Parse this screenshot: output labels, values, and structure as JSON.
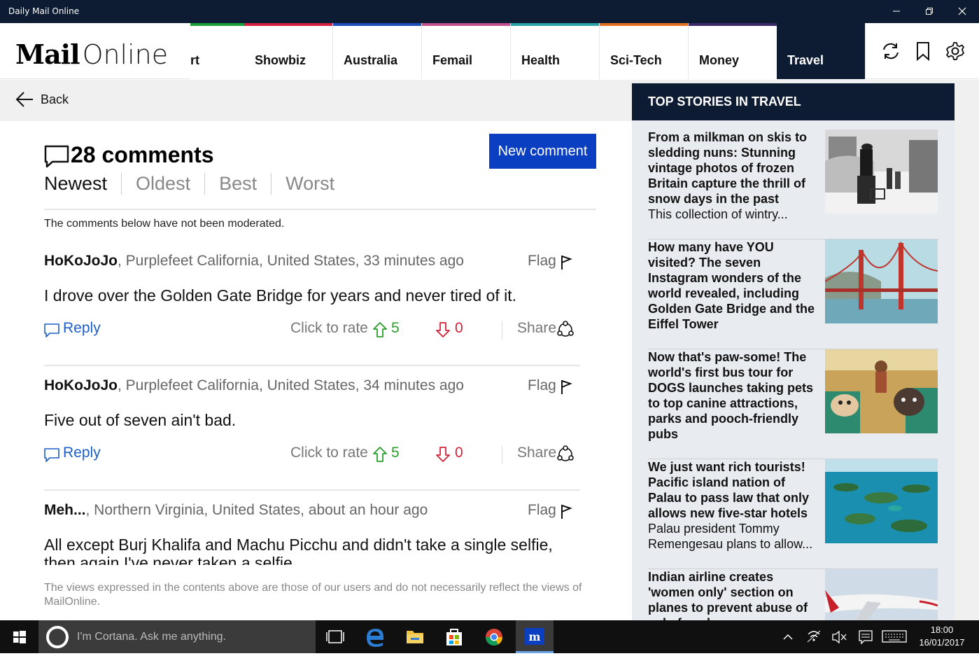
{
  "window": {
    "title": "Daily Mail Online"
  },
  "header": {
    "logo_mail": "Mail",
    "logo_online": "Online",
    "tabs": [
      {
        "label": "rt",
        "color": "#1a9e3a"
      },
      {
        "label": "Showbiz",
        "color": "#d61f43"
      },
      {
        "label": "Australia",
        "color": "#1d4fb8"
      },
      {
        "label": "Femail",
        "color": "#c05090"
      },
      {
        "label": "Health",
        "color": "#2aa3a8"
      },
      {
        "label": "Sci-Tech",
        "color": "#e07020"
      },
      {
        "label": "Money",
        "color": "#3a2a6a"
      },
      {
        "label": "Travel",
        "color": "#0d1b33",
        "active": true
      }
    ],
    "icons": [
      "refresh-icon",
      "bookmark-icon",
      "settings-icon"
    ]
  },
  "nav": {
    "back_label": "Back"
  },
  "comments": {
    "count_label": "28 comments",
    "new_comment_label": "New comment",
    "sorts": [
      "Newest",
      "Oldest",
      "Best",
      "Worst"
    ],
    "active_sort": "Newest",
    "notice": "The comments below have not been moderated.",
    "flag_label": "Flag",
    "reply_label": "Reply",
    "rate_label": "Click to rate",
    "share_label": "Share",
    "items": [
      {
        "author": "HoKoJoJo",
        "location": ", Purplefeet California, United States, 33 minutes ago",
        "text": "I  drove over the Golden Gate Bridge for years and never tired of it.",
        "up": "5",
        "down": "0"
      },
      {
        "author": "HoKoJoJo",
        "location": ", Purplefeet California, United States, 34 minutes ago",
        "text": "Five out of seven ain't bad.",
        "up": "5",
        "down": "0"
      },
      {
        "author": "Meh...",
        "location": ", Northern Virginia, United States, about an hour ago",
        "text": "All except Burj Khalifa and Machu Picchu and didn't take a single selfie, then again I've never taken a selfie."
      }
    ],
    "disclaimer": "The views expressed in the contents above are those of our users and do not necessarily reflect the views of MailOnline."
  },
  "sidebar": {
    "heading": "TOP STORIES IN TRAVEL",
    "stories": [
      {
        "headline": "From a milkman on skis to sledding nuns: Stunning vintage photos of frozen Britain capture the thrill of snow days in the past",
        "summary": "This collection of wintry..."
      },
      {
        "headline": "How many have YOU visited? The seven Instagram wonders of the world revealed, including Golden Gate Bridge and the Eiffel Tower",
        "summary": ""
      },
      {
        "headline": "Now that's paw-some! The world's first bus tour for DOGS launches taking pets to top canine attractions, parks and pooch-friendly pubs",
        "summary": ""
      },
      {
        "headline": "We just want rich tourists! Pacific island nation of Palau to pass law that only allows new five-star hotels",
        "summary": "Palau president Tommy Remengesau plans to allow..."
      },
      {
        "headline": "Indian airline creates 'women only' section on planes to prevent abuse of solo female",
        "summary": ""
      }
    ]
  },
  "taskbar": {
    "cortana_placeholder": "I'm Cortana. Ask me anything.",
    "time": "18:00",
    "date": "16/01/2017"
  }
}
